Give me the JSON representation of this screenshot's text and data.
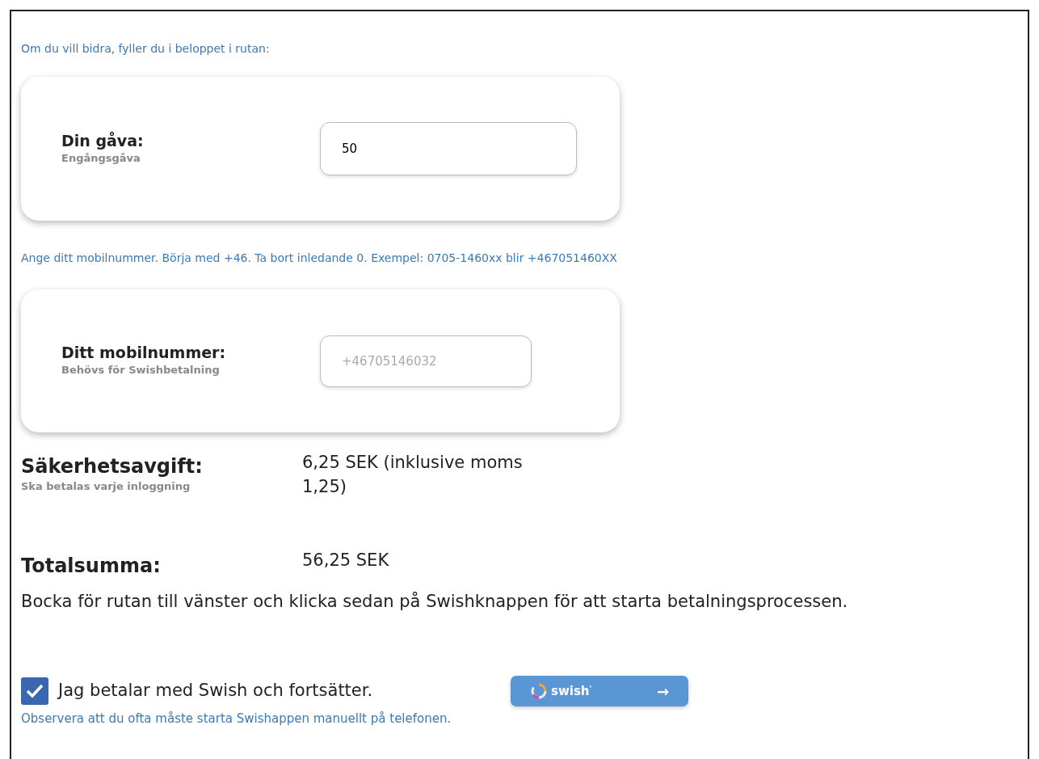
{
  "intro_text": "Om du vill bidra, fyller du i beloppet i rutan:",
  "gift_card": {
    "label": "Din gåva:",
    "sublabel": "Engångsgåva",
    "value": "50"
  },
  "phone_hint": "Ange ditt mobilnummer. Börja med +46. Ta bort inledande 0. Exempel: 0705-1460xx blir +467051460XX",
  "phone_card": {
    "label": "Ditt mobilnummer:",
    "sublabel": "Behövs för Swishbetalning",
    "placeholder": "+46705146032"
  },
  "fee": {
    "label": "Säkerhetsavgift:",
    "sublabel": "Ska betalas varje inloggning",
    "value": "6,25 SEK (inklusive moms 1,25)"
  },
  "total": {
    "label": "Totalsumma:",
    "value": "56,25 SEK"
  },
  "instruction": "Bocka för rutan till vänster och klicka sedan på Swishknappen för att starta betalningsprocessen.",
  "consent": {
    "label": "Jag betalar med Swish och fortsätter.",
    "checked": true
  },
  "swish_button": {
    "text": "swish",
    "superscript": "'",
    "arrow": "→"
  },
  "footer_note": "Observera att du ofta måste starta Swishappen manuellt på telefonen."
}
